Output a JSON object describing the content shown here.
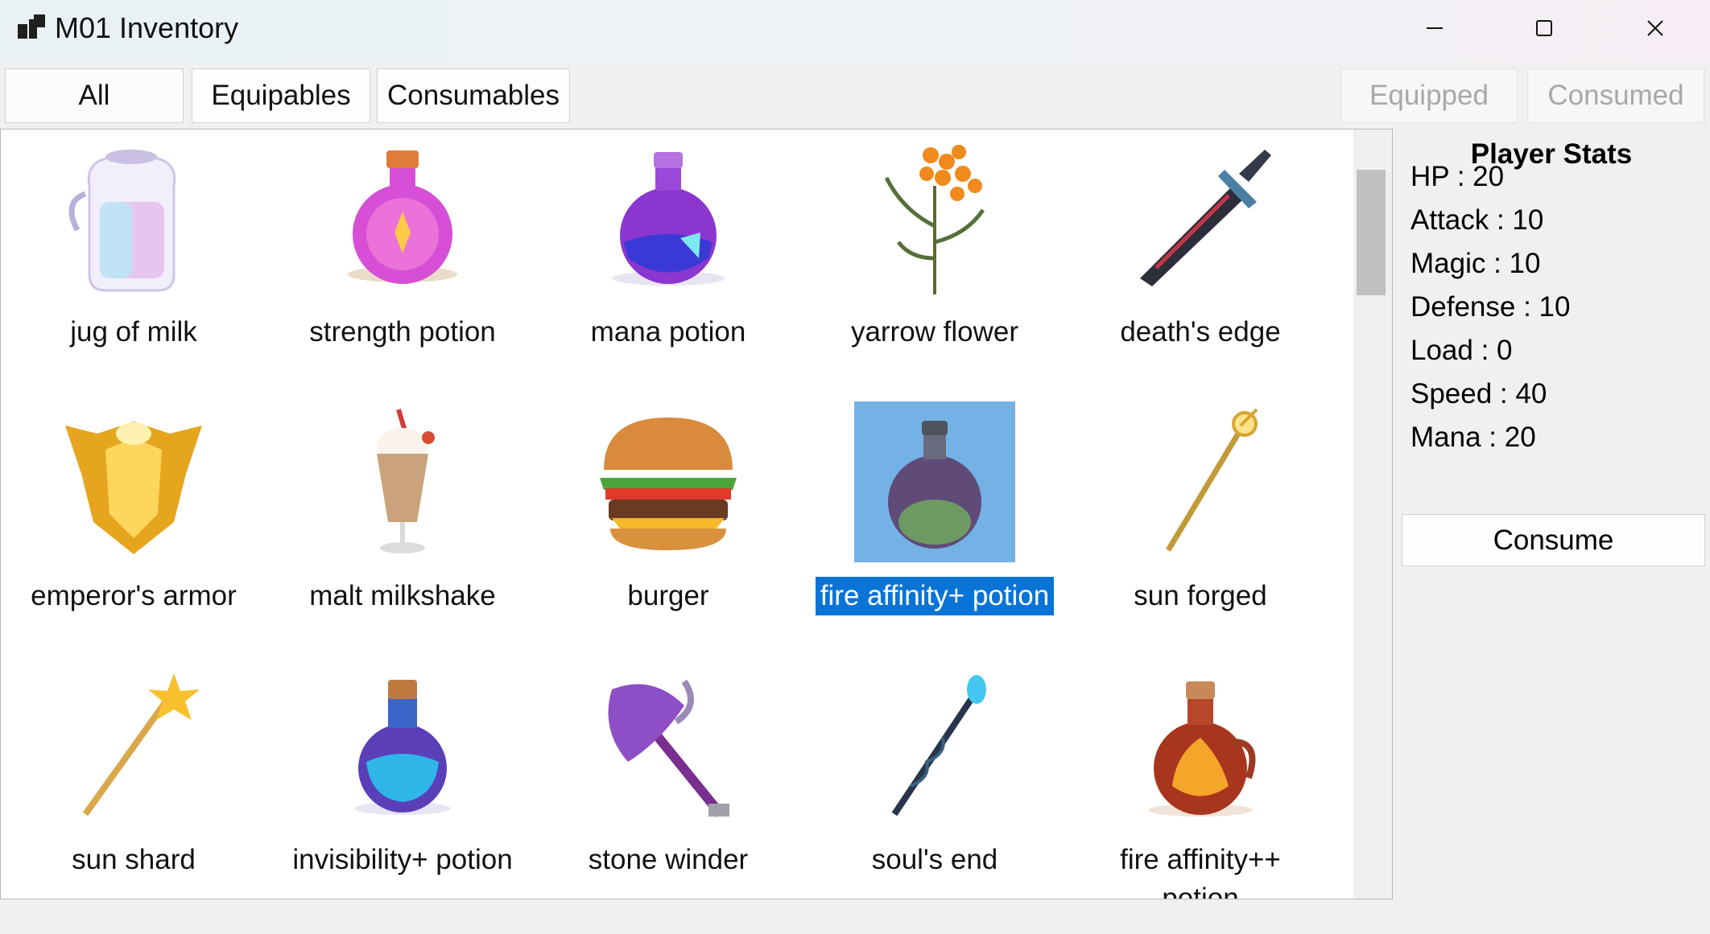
{
  "window": {
    "title": "M01 Inventory",
    "controls": {
      "minimize": "minimize-icon",
      "maximize": "maximize-icon",
      "close": "close-icon"
    }
  },
  "tabs": {
    "all": "All",
    "equipables": "Equipables",
    "consumables": "Consumables",
    "equipped": "Equipped",
    "consumed": "Consumed"
  },
  "items": [
    {
      "name": "jug of milk",
      "icon": "milk-jug-icon"
    },
    {
      "name": "strength potion",
      "icon": "pink-potion-icon"
    },
    {
      "name": "mana potion",
      "icon": "purple-potion-icon"
    },
    {
      "name": "yarrow flower",
      "icon": "flower-icon"
    },
    {
      "name": "death's edge",
      "icon": "sword-icon"
    },
    {
      "name": "emperor's armor",
      "icon": "armor-icon"
    },
    {
      "name": "malt milkshake",
      "icon": "milkshake-icon"
    },
    {
      "name": "burger",
      "icon": "burger-icon"
    },
    {
      "name": "fire affinity+ potion",
      "icon": "dark-potion-icon",
      "selected": true
    },
    {
      "name": "sun forged",
      "icon": "golden-staff-icon"
    },
    {
      "name": "sun shard",
      "icon": "sun-wand-icon"
    },
    {
      "name": "invisibility+ potion",
      "icon": "blue-potion-icon"
    },
    {
      "name": "stone winder",
      "icon": "axe-icon"
    },
    {
      "name": "soul's end",
      "icon": "dark-staff-icon"
    },
    {
      "name": "fire affinity++ potion",
      "icon": "fire-potion-icon"
    }
  ],
  "stats": {
    "title": "Player Stats",
    "hp": "HP :   20",
    "attack": "Attack :   10",
    "magic": "Magic :   10",
    "defense": "Defense :   10",
    "load": "Load :   0",
    "speed": "Speed :   40",
    "mana": "Mana :   20"
  },
  "actions": {
    "consume": "Consume"
  }
}
